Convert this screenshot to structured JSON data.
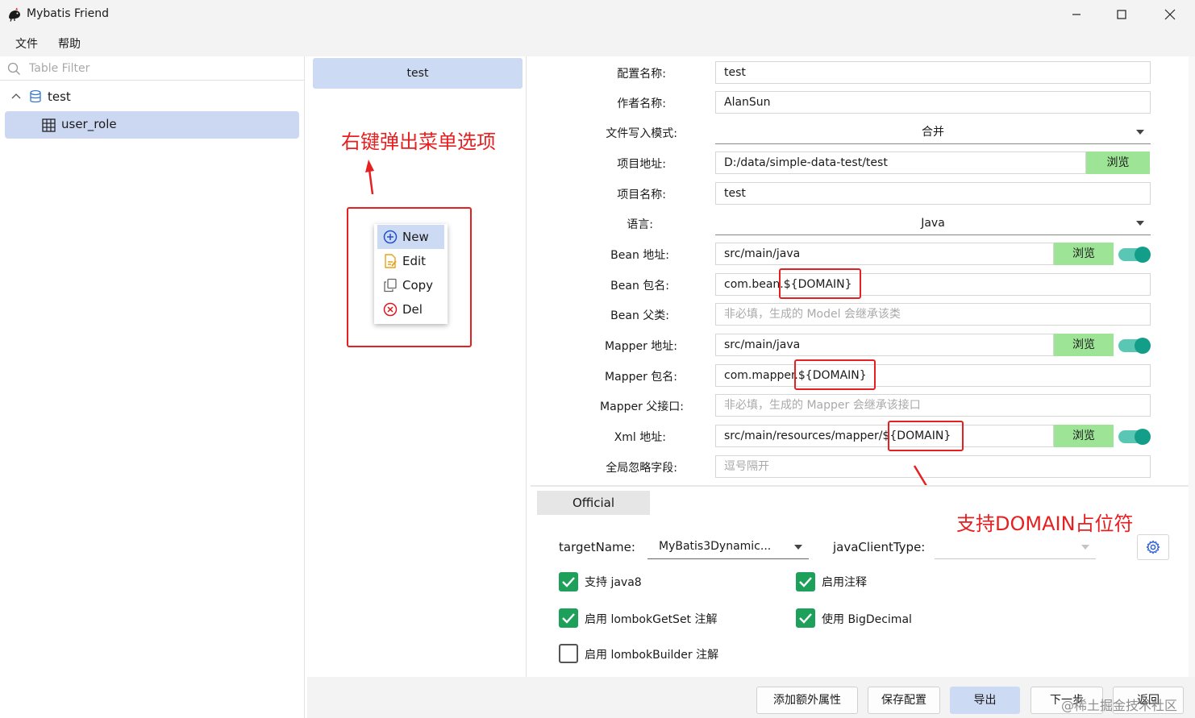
{
  "window": {
    "title": "Mybatis Friend"
  },
  "menubar": {
    "items": [
      {
        "label": "文件"
      },
      {
        "label": "帮助"
      }
    ]
  },
  "tree": {
    "filter_placeholder": "Table Filter",
    "database": "test",
    "tables": [
      "user_role"
    ]
  },
  "config_list": {
    "items": [
      "test"
    ]
  },
  "context_menu": {
    "items": [
      {
        "label": "New",
        "icon": "plus-circle-icon"
      },
      {
        "label": "Edit",
        "icon": "edit-document-icon"
      },
      {
        "label": "Copy",
        "icon": "copy-icon"
      },
      {
        "label": "Del",
        "icon": "delete-circle-icon"
      }
    ]
  },
  "annotations": {
    "menu_note": "右键弹出菜单选项",
    "domain_note": "支持DOMAIN占位符"
  },
  "form": {
    "config_name": {
      "label": "配置名称:",
      "value": "test"
    },
    "author": {
      "label": "作者名称:",
      "value": "AlanSun"
    },
    "write_mode": {
      "label": "文件写入模式:",
      "value": "合并"
    },
    "project_path": {
      "label": "项目地址:",
      "value": "D:/data/simple-data-test/test",
      "button": "浏览"
    },
    "project_name": {
      "label": "项目名称:",
      "value": "test"
    },
    "language": {
      "label": "语言:",
      "value": "Java"
    },
    "bean_path": {
      "label": "Bean 地址:",
      "value": "src/main/java",
      "button": "浏览",
      "enabled": true
    },
    "bean_package": {
      "label": "Bean 包名:",
      "value": "com.bean.${DOMAIN}"
    },
    "bean_parent": {
      "label": "Bean 父类:",
      "placeholder": "非必填，生成的 Model 会继承该类"
    },
    "mapper_path": {
      "label": "Mapper 地址:",
      "value": "src/main/java",
      "button": "浏览",
      "enabled": true
    },
    "mapper_package": {
      "label": "Mapper 包名:",
      "value": "com.mapper.${DOMAIN}"
    },
    "mapper_parent": {
      "label": "Mapper 父接口:",
      "placeholder": "非必填，生成的 Mapper 会继承该接口"
    },
    "xml_path": {
      "label": "Xml 地址:",
      "value": "src/main/resources/mapper/${DOMAIN}",
      "button": "浏览",
      "enabled": true
    },
    "ignore_fields": {
      "label": "全局忽略字段:",
      "placeholder": "逗号隔开"
    }
  },
  "official": {
    "tab_label": "Official",
    "target_name": {
      "label": "targetName:",
      "value": "MyBatis3Dynamic..."
    },
    "java_client_type": {
      "label": "javaClientType:",
      "value": ""
    },
    "options": [
      {
        "label": "支持 java8",
        "checked": true
      },
      {
        "label": "启用注释",
        "checked": true
      },
      {
        "label": "启用 lombokGetSet 注解",
        "checked": true
      },
      {
        "label": "使用 BigDecimal",
        "checked": true
      },
      {
        "label": "启用 lombokBuilder 注解",
        "checked": false
      }
    ]
  },
  "footer": {
    "buttons": [
      "添加额外属性",
      "保存配置",
      "导出",
      "下一步",
      "返回"
    ],
    "watermark": "@稀土掘金技术社区"
  },
  "colors": {
    "accent_selected": "#cddaf4",
    "browse_green": "#9ee496",
    "toggle_teal": "#139e89",
    "checkbox_green": "#1da05a",
    "annotation_red": "#e62020"
  }
}
